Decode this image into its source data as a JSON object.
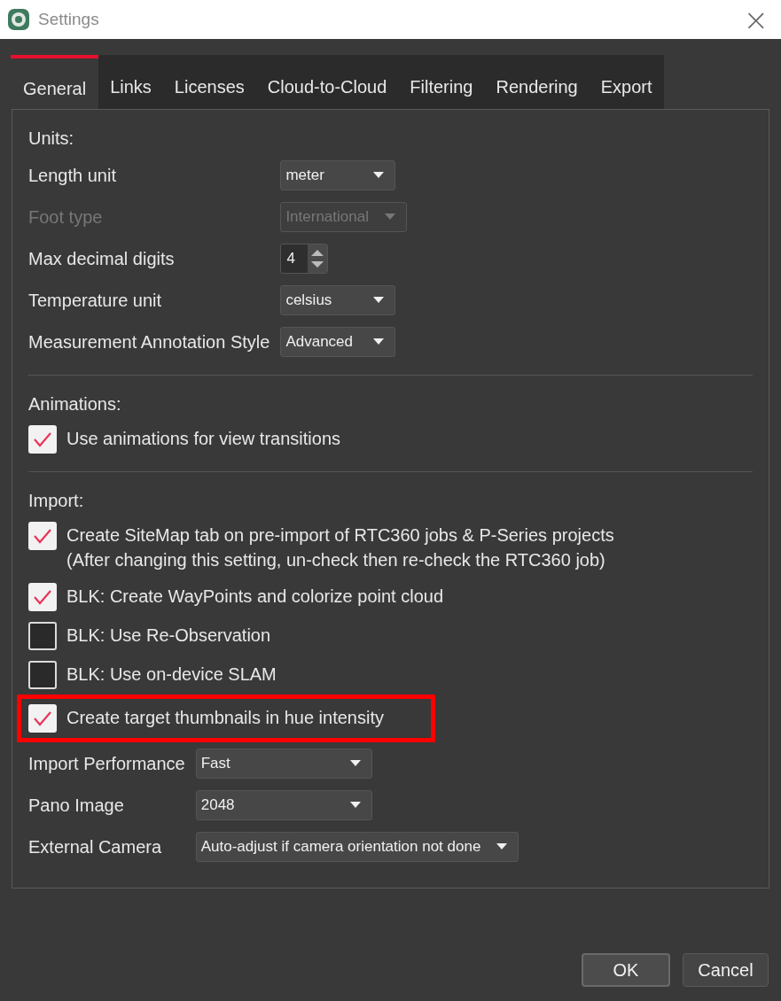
{
  "window": {
    "title": "Settings",
    "close": "×"
  },
  "tabs": [
    {
      "label": "General",
      "selected": true
    },
    {
      "label": "Links",
      "selected": false
    },
    {
      "label": "Licenses",
      "selected": false
    },
    {
      "label": "Cloud-to-Cloud",
      "selected": false
    },
    {
      "label": "Filtering",
      "selected": false
    },
    {
      "label": "Rendering",
      "selected": false
    },
    {
      "label": "Export",
      "selected": false
    }
  ],
  "sections": [
    {
      "title": "Units:",
      "items": [
        {
          "kind": "dropdown",
          "label": "Length unit",
          "value": "meter",
          "disabled": false
        },
        {
          "kind": "dropdown",
          "label": "Foot type",
          "value": "International",
          "disabled": true
        },
        {
          "kind": "spinner",
          "label": "Max decimal digits",
          "value": "4",
          "disabled": false
        },
        {
          "kind": "dropdown",
          "label": "Temperature unit",
          "value": "celsius",
          "disabled": false
        },
        {
          "kind": "dropdown",
          "label": "Measurement Annotation Style",
          "value": "Advanced",
          "disabled": false
        }
      ]
    },
    {
      "title": "Animations:",
      "items": [
        {
          "kind": "checkbox",
          "label": "Use animations for view transitions",
          "checked": true
        }
      ]
    },
    {
      "title": "Import:",
      "items": [
        {
          "kind": "checkbox",
          "label": "Create SiteMap tab on pre-import of RTC360 jobs & P-Series projects\n(After changing this setting, un-check then re-check the RTC360 job)",
          "checked": true
        },
        {
          "kind": "checkbox",
          "label": "BLK: Create WayPoints and colorize point cloud",
          "checked": true
        },
        {
          "kind": "checkbox",
          "label": "BLK: Use Re-Observation",
          "checked": false
        },
        {
          "kind": "checkbox",
          "label": "BLK: Use on-device SLAM",
          "checked": false
        },
        {
          "kind": "checkbox",
          "label": "Create target thumbnails in hue intensity",
          "checked": true,
          "highlighted": true
        },
        {
          "kind": "dropdown",
          "label": "Import Performance",
          "value": "Fast",
          "disabled": false
        },
        {
          "kind": "dropdown",
          "label": "Pano Image",
          "value": "2048",
          "disabled": false
        },
        {
          "kind": "dropdown",
          "label": "External Camera",
          "value": "Auto-adjust if camera orientation not done",
          "disabled": false
        }
      ]
    }
  ],
  "buttons": [
    "OK",
    "Cancel"
  ]
}
